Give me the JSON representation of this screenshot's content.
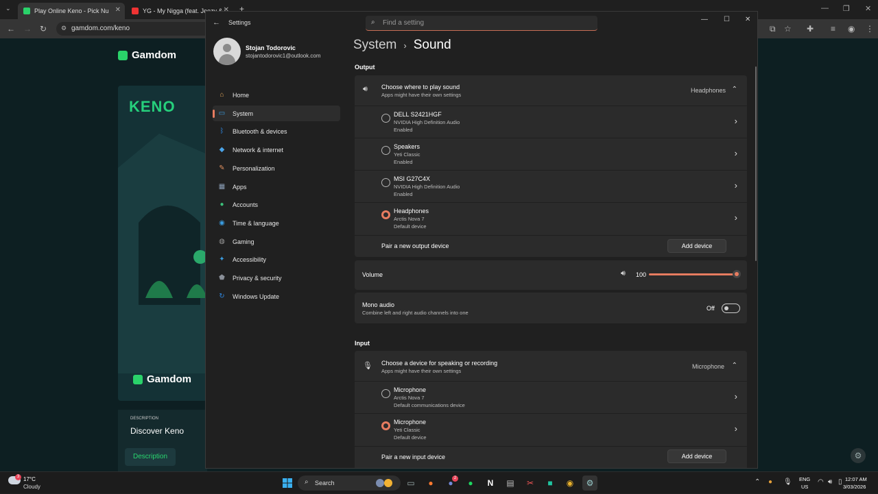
{
  "browser": {
    "tabs": [
      {
        "title": "Play Online Keno - Pick Nu",
        "active": true
      },
      {
        "title": "YG - My Nigga (feat. Jeezy & R",
        "active": false
      }
    ],
    "new_tab": "+",
    "url": "gamdom.com/keno"
  },
  "webpage": {
    "brand": "Gamdom",
    "game_logo": "KENO",
    "brand_bottom": "Gamdom",
    "desc_label": "DESCRIPTION",
    "desc_title": "Discover Keno",
    "desc_button": "Description"
  },
  "settings": {
    "app_title": "Settings",
    "search_placeholder": "Find a setting",
    "user": {
      "name": "Stojan Todorovic",
      "email": "stojantodorovic1@outlook.com"
    },
    "nav": [
      {
        "label": "Home",
        "icon": "home-icon",
        "color": "#e0a45a"
      },
      {
        "label": "System",
        "icon": "system-icon",
        "color": "#3a9ce0"
      },
      {
        "label": "Bluetooth & devices",
        "icon": "bluetooth-icon",
        "color": "#2f87e0"
      },
      {
        "label": "Network & internet",
        "icon": "wifi-icon",
        "color": "#4aa3e8"
      },
      {
        "label": "Personalization",
        "icon": "brush-icon",
        "color": "#e09060"
      },
      {
        "label": "Apps",
        "icon": "apps-icon",
        "color": "#8a9db5"
      },
      {
        "label": "Accounts",
        "icon": "accounts-icon",
        "color": "#3cbf7a"
      },
      {
        "label": "Time & language",
        "icon": "globe-icon",
        "color": "#3a9ce0"
      },
      {
        "label": "Gaming",
        "icon": "gamepad-icon",
        "color": "#9a9a9a"
      },
      {
        "label": "Accessibility",
        "icon": "accessibility-icon",
        "color": "#3a9ce0"
      },
      {
        "label": "Privacy & security",
        "icon": "shield-icon",
        "color": "#8a8f98"
      },
      {
        "label": "Windows Update",
        "icon": "update-icon",
        "color": "#2f87e0"
      }
    ],
    "breadcrumb": {
      "root": "System",
      "sep": "›",
      "current": "Sound"
    },
    "output": {
      "heading": "Output",
      "header_title": "Choose where to play sound",
      "header_sub": "Apps might have their own settings",
      "header_value": "Headphones",
      "devices": [
        {
          "name": "DELL S2421HGF",
          "driver": "NVIDIA High Definition Audio",
          "status": "Enabled",
          "selected": false
        },
        {
          "name": "Speakers",
          "driver": "Yeti Classic",
          "status": "Enabled",
          "selected": false
        },
        {
          "name": "MSI G27C4X",
          "driver": "NVIDIA High Definition Audio",
          "status": "Enabled",
          "selected": false
        },
        {
          "name": "Headphones",
          "driver": "Arctis Nova 7",
          "status": "Default device",
          "selected": true
        }
      ],
      "pair_label": "Pair a new output device",
      "add_button": "Add device"
    },
    "volume": {
      "label": "Volume",
      "value": "100",
      "level": 1.0
    },
    "mono": {
      "title": "Mono audio",
      "sub": "Combine left and right audio channels into one",
      "state": "Off"
    },
    "input": {
      "heading": "Input",
      "header_title": "Choose a device for speaking or recording",
      "header_sub": "Apps might have their own settings",
      "header_value": "Microphone",
      "devices": [
        {
          "name": "Microphone",
          "driver": "Arctis Nova 7",
          "status": "Default communications device",
          "selected": false
        },
        {
          "name": "Microphone",
          "driver": "Yeti Classic",
          "status": "Default device",
          "selected": true
        }
      ],
      "pair_label": "Pair a new input device",
      "add_button": "Add device"
    }
  },
  "taskbar": {
    "weather_temp": "17°C",
    "weather_desc": "Cloudy",
    "weather_badge": "3",
    "search_label": "Search",
    "discord_badge": "2",
    "lang_line1": "ENG",
    "lang_line2": "US",
    "time": "12:07 AM",
    "date": "3/03/2026"
  },
  "colors": {
    "accent": "#e77c60",
    "brand_green": "#2ad26a"
  }
}
